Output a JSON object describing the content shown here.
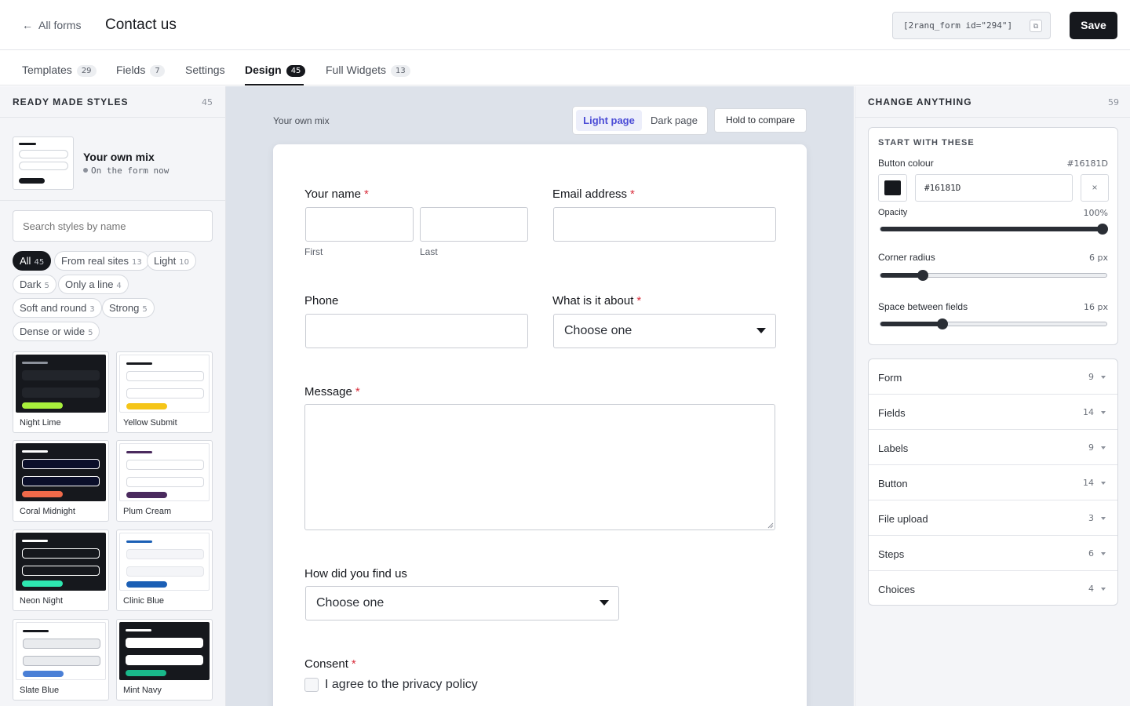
{
  "header": {
    "back_arrow": "←",
    "back_label": "All forms",
    "title": "Contact us",
    "shortcode": "[2ranq_form id=\"294\"]",
    "copy_icon": "⧉",
    "save_label": "Save"
  },
  "tabs": [
    {
      "label": "Templates",
      "count": "29"
    },
    {
      "label": "Fields",
      "count": "7"
    },
    {
      "label": "Settings",
      "count": ""
    },
    {
      "label": "Design",
      "count": "45"
    },
    {
      "label": "Full Widgets",
      "count": "13"
    }
  ],
  "left": {
    "heading": "READY MADE STYLES",
    "count": "45",
    "current": {
      "name": "Your own mix",
      "status": "On the form now"
    },
    "search_placeholder": "Search styles by name",
    "filters": [
      {
        "label": "All",
        "count": "45"
      },
      {
        "label": "From real sites",
        "count": "13"
      },
      {
        "label": "Light",
        "count": "10"
      },
      {
        "label": "Dark",
        "count": "5"
      },
      {
        "label": "Only a line",
        "count": "4"
      },
      {
        "label": "Soft and round",
        "count": "3"
      },
      {
        "label": "Strong",
        "count": "5"
      },
      {
        "label": "Dense or wide",
        "count": "5"
      }
    ],
    "styles": [
      {
        "name": "Night Lime",
        "bg": "#16181d",
        "line": "#8c919b",
        "field": "#22252b",
        "border": "#22252b",
        "button": "#a8f03c"
      },
      {
        "name": "Yellow Submit",
        "bg": "#ffffff",
        "line": "#16181d",
        "field": "#ffffff",
        "border": "#d6d9df",
        "button": "#f5c518"
      },
      {
        "name": "Coral Midnight",
        "bg": "#16181d",
        "line": "#ffffff",
        "field": "#0b0f2a",
        "border": "#ffffff",
        "button": "#f06a4a"
      },
      {
        "name": "Plum Cream",
        "bg": "#ffffff",
        "line": "#4a2a5e",
        "field": "#ffffff",
        "border": "#d6d9df",
        "button": "#4a2a5e"
      },
      {
        "name": "Neon Night",
        "bg": "#16181d",
        "line": "#ffffff",
        "field": "#16181d",
        "border": "#ffffff",
        "button": "#2ee6b0"
      },
      {
        "name": "Clinic Blue",
        "bg": "#ffffff",
        "line": "#1b5fb5",
        "field": "#f4f5f8",
        "border": "#e3e5ea",
        "button": "#1b5fb5"
      },
      {
        "name": "Slate Blue",
        "bg": "#ffffff",
        "line": "#16181d",
        "field": "#e9ebee",
        "border": "#b6bac2",
        "button": "#4a7fd6"
      },
      {
        "name": "Mint Navy",
        "bg": "#16181d",
        "line": "#ffffff",
        "field": "#ffffff",
        "border": "#ffffff",
        "button": "#19b88a"
      }
    ]
  },
  "canvas": {
    "mix_label": "Your own mix",
    "light_label": "Light page",
    "dark_label": "Dark page",
    "compare_label": "Hold to compare",
    "form": {
      "name_label": "Your name",
      "first_label": "First",
      "last_label": "Last",
      "email_label": "Email address",
      "phone_label": "Phone",
      "topic_label": "What is it about",
      "topic_value": "Choose one",
      "message_label": "Message",
      "source_label": "How did you find us",
      "source_value": "Choose one",
      "consent_label": "Consent",
      "consent_text": "I agree to the privacy policy",
      "required_mark": "*"
    }
  },
  "right": {
    "heading": "CHANGE ANYTHING",
    "count": "59",
    "card_heading": "START WITH THESE",
    "button_colour_label": "Button colour",
    "button_colour_value": "#16181D",
    "hex_value": "#16181D",
    "clear_icon": "×",
    "opacity_label": "Opacity",
    "opacity_value": "100%",
    "opacity_fraction": 1.0,
    "radius_label": "Corner radius",
    "radius_value": "6 px",
    "radius_fraction": 0.17,
    "space_label": "Space between fields",
    "space_value": "16 px",
    "space_fraction": 0.26,
    "sections": [
      {
        "label": "Form",
        "count": "9"
      },
      {
        "label": "Fields",
        "count": "14"
      },
      {
        "label": "Labels",
        "count": "9"
      },
      {
        "label": "Button",
        "count": "14"
      },
      {
        "label": "File upload",
        "count": "3"
      },
      {
        "label": "Steps",
        "count": "6"
      },
      {
        "label": "Choices",
        "count": "4"
      }
    ]
  }
}
